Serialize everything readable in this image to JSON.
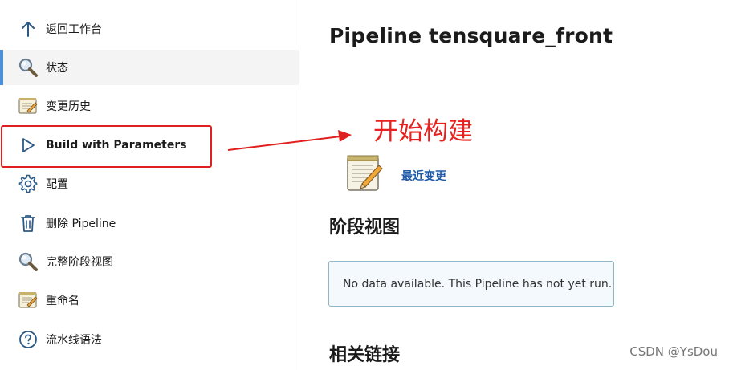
{
  "sidebar": {
    "items": [
      {
        "label": "返回工作台",
        "icon": "arrow-up-icon"
      },
      {
        "label": "状态",
        "icon": "magnifier-icon"
      },
      {
        "label": "变更历史",
        "icon": "notepad-icon"
      },
      {
        "label": "Build with Parameters",
        "icon": "play-icon"
      },
      {
        "label": "配置",
        "icon": "gear-icon"
      },
      {
        "label": "删除 Pipeline",
        "icon": "trash-icon"
      },
      {
        "label": "完整阶段视图",
        "icon": "magnifier-icon"
      },
      {
        "label": "重命名",
        "icon": "notepad-icon"
      },
      {
        "label": "流水线语法",
        "icon": "help-circle-icon"
      }
    ]
  },
  "main": {
    "title": "Pipeline tensquare_front",
    "recent_changes_label": "最近变更",
    "stage_view_title": "阶段视图",
    "no_data_message": "No data available. This Pipeline has not yet run.",
    "related_links_title": "相关链接"
  },
  "annotation": {
    "text": "开始构建",
    "color": "#e8201e"
  },
  "watermark": "CSDN @YsDou",
  "colors": {
    "accent": "#4a90d9",
    "link": "#1e5aa8",
    "highlight_box": "#e02020"
  }
}
